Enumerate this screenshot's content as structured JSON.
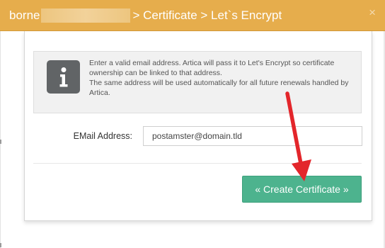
{
  "dialog": {
    "title_prefix": "borne",
    "title_suffix": "> Certificate > Let`s Encrypt",
    "close_glyph": "×",
    "colors": {
      "header": "#e6ad4c",
      "button": "#4db38e",
      "annotation_arrow": "#e3262b"
    }
  },
  "info": {
    "icon": "info-icon",
    "line1": "Enter a valid email address. Artica will pass it to Let's Encrypt so certificate ownership can be linked to that address.",
    "line2": "The same address will be used automatically for all future renewals handled by Artica."
  },
  "form": {
    "email_label": "EMail Address:",
    "email_value": "postamster@domain.tld"
  },
  "actions": {
    "create_label": "« Create Certificate »"
  }
}
